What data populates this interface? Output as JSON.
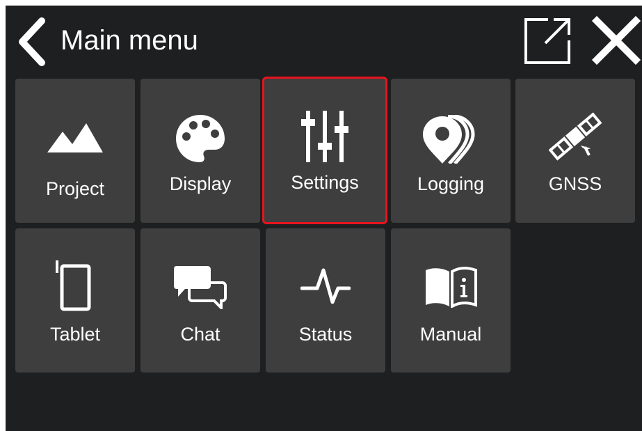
{
  "header": {
    "title": "Main menu",
    "back_icon": "chevron-left-icon",
    "popout_icon": "open-external-icon",
    "close_icon": "close-icon"
  },
  "tiles": [
    {
      "label": "Project",
      "icon": "mountains-icon"
    },
    {
      "label": "Display",
      "icon": "palette-icon"
    },
    {
      "label": "Settings",
      "icon": "sliders-icon",
      "selected": true
    },
    {
      "label": "Logging",
      "icon": "map-pins-icon"
    },
    {
      "label": "GNSS",
      "icon": "satellite-icon"
    },
    {
      "label": "Tablet",
      "icon": "tablet-icon"
    },
    {
      "label": "Chat",
      "icon": "chat-bubbles-icon"
    },
    {
      "label": "Status",
      "icon": "pulse-icon"
    },
    {
      "label": "Manual",
      "icon": "manual-book-icon"
    }
  ],
  "colors": {
    "background": "#1e1f21",
    "tile": "#3e3e3e",
    "highlight": "#e8141e",
    "foreground": "#ffffff"
  }
}
